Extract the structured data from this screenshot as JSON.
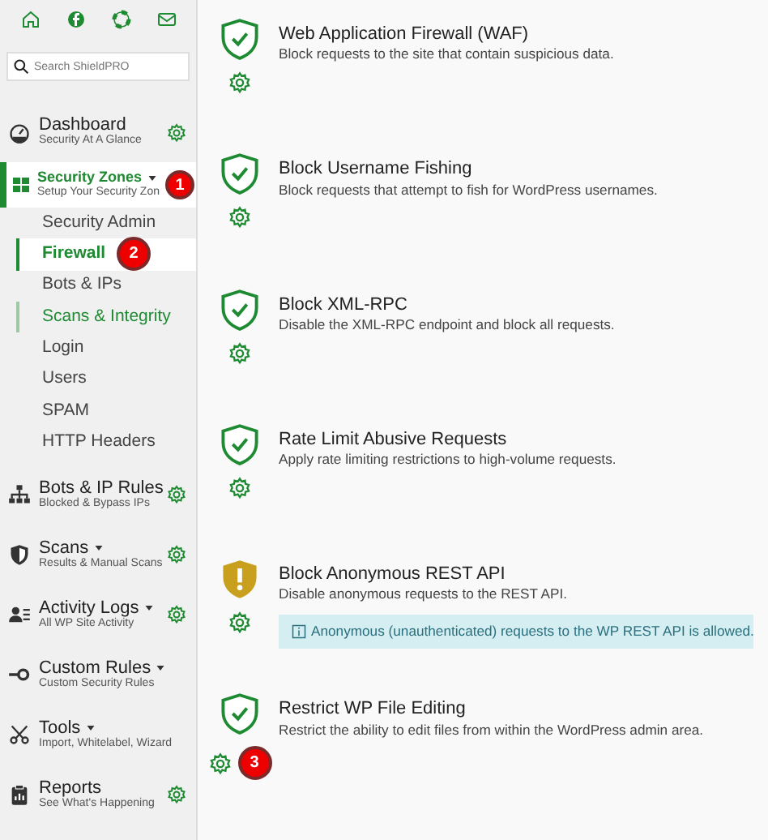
{
  "sidebar": {
    "search": {
      "placeholder": "Search ShieldPRO"
    },
    "menu": [
      {
        "title": "Dashboard",
        "subtitle": "Security At A Glance",
        "dropdown": false,
        "settings": true,
        "selected": false
      },
      {
        "title": "Security Zones",
        "subtitle": "Setup Your Security Zon",
        "dropdown": true,
        "settings": false,
        "selected": true,
        "badge": "1",
        "children": [
          {
            "label": "Security Admin",
            "selected": false,
            "hovered": false
          },
          {
            "label": "Firewall",
            "selected": true,
            "hovered": false,
            "badge": "2"
          },
          {
            "label": "Bots & IPs",
            "selected": false,
            "hovered": false
          },
          {
            "label": "Scans & Integrity",
            "selected": false,
            "hovered": true
          },
          {
            "label": "Login",
            "selected": false,
            "hovered": false
          },
          {
            "label": "Users",
            "selected": false,
            "hovered": false
          },
          {
            "label": "SPAM",
            "selected": false,
            "hovered": false
          },
          {
            "label": "HTTP Headers",
            "selected": false,
            "hovered": false
          }
        ]
      },
      {
        "title": "Bots & IP Rules",
        "subtitle": "Blocked & Bypass IPs",
        "dropdown": false,
        "settings": true,
        "selected": false
      },
      {
        "title": "Scans",
        "subtitle": "Results & Manual Scans",
        "dropdown": true,
        "settings": true,
        "selected": false
      },
      {
        "title": "Activity Logs",
        "subtitle": "All WP Site Activity",
        "dropdown": true,
        "settings": true,
        "selected": false
      },
      {
        "title": "Custom Rules",
        "subtitle": "Custom Security Rules",
        "dropdown": true,
        "settings": false,
        "selected": false
      },
      {
        "title": "Tools",
        "subtitle": "Import, Whitelabel, Wizard",
        "dropdown": true,
        "settings": false,
        "selected": false
      },
      {
        "title": "Reports",
        "subtitle": "See What's Happening",
        "dropdown": false,
        "settings": true,
        "selected": false
      }
    ]
  },
  "features": [
    {
      "kind": "ok",
      "title": "Web Application Firewall (WAF)",
      "description": "Block requests to the site that contain suspicious data."
    },
    {
      "kind": "ok",
      "title": "Block Username Fishing",
      "description": "Block requests that attempt to fish for WordPress usernames."
    },
    {
      "kind": "ok",
      "title": "Block XML-RPC",
      "description": "Disable the XML-RPC endpoint and block all requests."
    },
    {
      "kind": "ok",
      "title": "Rate Limit Abusive Requests",
      "description": "Apply rate limiting restrictions to high-volume requests."
    },
    {
      "kind": "warning",
      "title": "Block Anonymous REST API",
      "description": "Disable anonymous requests to the REST API.",
      "notice": "Anonymous (unauthenticated) requests to the WP REST API is allowed."
    },
    {
      "kind": "ok",
      "title": "Restrict WP File Editing",
      "description": "Restrict the ability to edit files from within the WordPress admin area.",
      "badge": "3"
    }
  ]
}
